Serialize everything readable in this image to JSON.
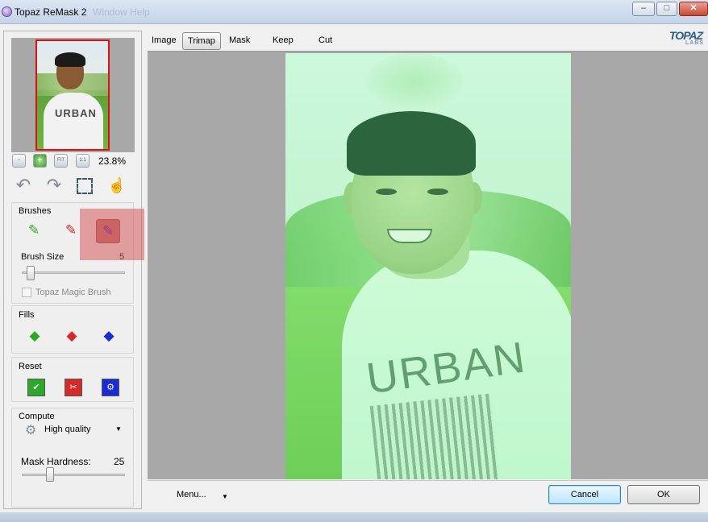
{
  "window": {
    "title": "Topaz ReMask 2",
    "faded_title": "Window   Help"
  },
  "zoom": {
    "buttons": [
      "zoom-out",
      "zoom-in",
      "FIT",
      "1:1"
    ],
    "value": "23.8%"
  },
  "brushes": {
    "label": "Brushes",
    "size_label": "Brush Size",
    "size_value": "5",
    "magic_brush": "Topaz Magic Brush",
    "size_fraction": 0.05
  },
  "fills": {
    "label": "Fills"
  },
  "reset": {
    "label": "Reset"
  },
  "compute": {
    "label": "Compute",
    "quality": "High quality",
    "hardness_label": "Mask Hardness:",
    "hardness_value": "25",
    "hardness_fraction": 0.25
  },
  "tabs": [
    "Image",
    "Trimap",
    "Mask",
    "Keep",
    "Cut"
  ],
  "active_tab": "Trimap",
  "logo": {
    "main": "TOPAZ",
    "sub": "LABS"
  },
  "photo": {
    "shirt_text": "URBAN"
  },
  "bottom": {
    "menu_label": "Menu...",
    "cancel_label": "Cancel",
    "ok_label": "OK"
  },
  "colors": {
    "accent_highlight": "#d65a5a",
    "trimap_tint": "#78ff96",
    "keep_green": "#2ea82a",
    "cut_red": "#d42a2a",
    "compute_blue": "#1a2ad4"
  },
  "icons": [
    "undo-icon",
    "redo-icon",
    "selection-icon",
    "hand-icon",
    "keep-brush-icon",
    "cut-brush-icon",
    "compute-brush-icon",
    "keep-fill-icon",
    "cut-fill-icon",
    "compute-fill-icon",
    "keep-reset-icon",
    "cut-reset-icon",
    "compute-reset-icon",
    "quality-gear-icon"
  ]
}
